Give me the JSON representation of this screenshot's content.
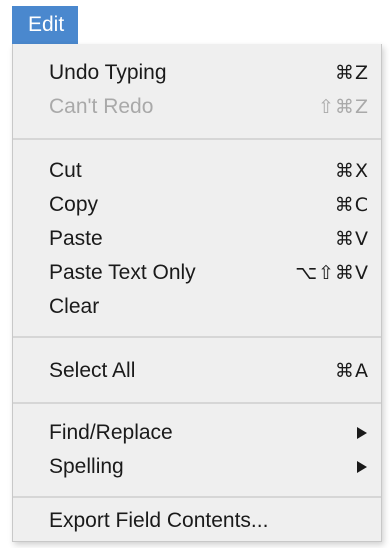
{
  "menu": {
    "title": "Edit",
    "items": [
      {
        "label": "Undo Typing",
        "shortcut": "⌘Z",
        "enabled": true
      },
      {
        "label": "Can't Redo",
        "shortcut": "⇧⌘Z",
        "enabled": false
      },
      {
        "label": "Cut",
        "shortcut": "⌘X",
        "enabled": true
      },
      {
        "label": "Copy",
        "shortcut": "⌘C",
        "enabled": true
      },
      {
        "label": "Paste",
        "shortcut": "⌘V",
        "enabled": true
      },
      {
        "label": "Paste Text Only",
        "shortcut": "⌥⇧⌘V",
        "enabled": true
      },
      {
        "label": "Clear",
        "shortcut": "",
        "enabled": true
      },
      {
        "label": "Select All",
        "shortcut": "⌘A",
        "enabled": true
      },
      {
        "label": "Find/Replace",
        "submenu_icon": "right-triangle-icon",
        "enabled": true
      },
      {
        "label": "Spelling",
        "submenu_icon": "right-triangle-icon",
        "enabled": true
      },
      {
        "label": "Export Field Contents...",
        "shortcut": "",
        "enabled": true
      }
    ]
  },
  "colors": {
    "title_bg": "#4a88ce",
    "menu_bg": "#efefef",
    "disabled_text": "#a9a9a9"
  }
}
